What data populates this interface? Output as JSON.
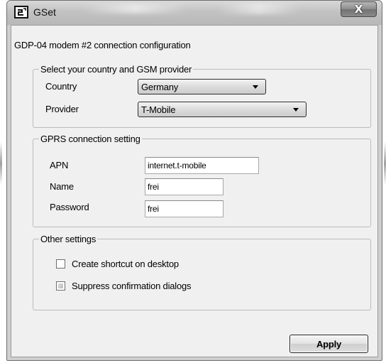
{
  "window": {
    "title": "GSet",
    "close_label": "X",
    "icon": "gset-app-icon"
  },
  "dialog": {
    "heading": "GDP-04 modem #2 connection configuration"
  },
  "provider_group": {
    "legend": "Select your country and GSM provider",
    "country_label": "Country",
    "country_value": "Germany",
    "provider_label": "Provider",
    "provider_value": "T-Mobile"
  },
  "gprs_group": {
    "legend": "GPRS connection setting",
    "apn_label": "APN",
    "apn_value": "internet.t-mobile",
    "name_label": "Name",
    "name_value": "frei",
    "password_label": "Password",
    "password_value": "frei"
  },
  "other_group": {
    "legend": "Other settings",
    "create_shortcut_label": "Create shortcut on desktop",
    "create_shortcut_checked": false,
    "suppress_confirm_label": "Suppress confirmation dialogs",
    "suppress_confirm_state": "indeterminate"
  },
  "buttons": {
    "apply_label": "Apply"
  }
}
